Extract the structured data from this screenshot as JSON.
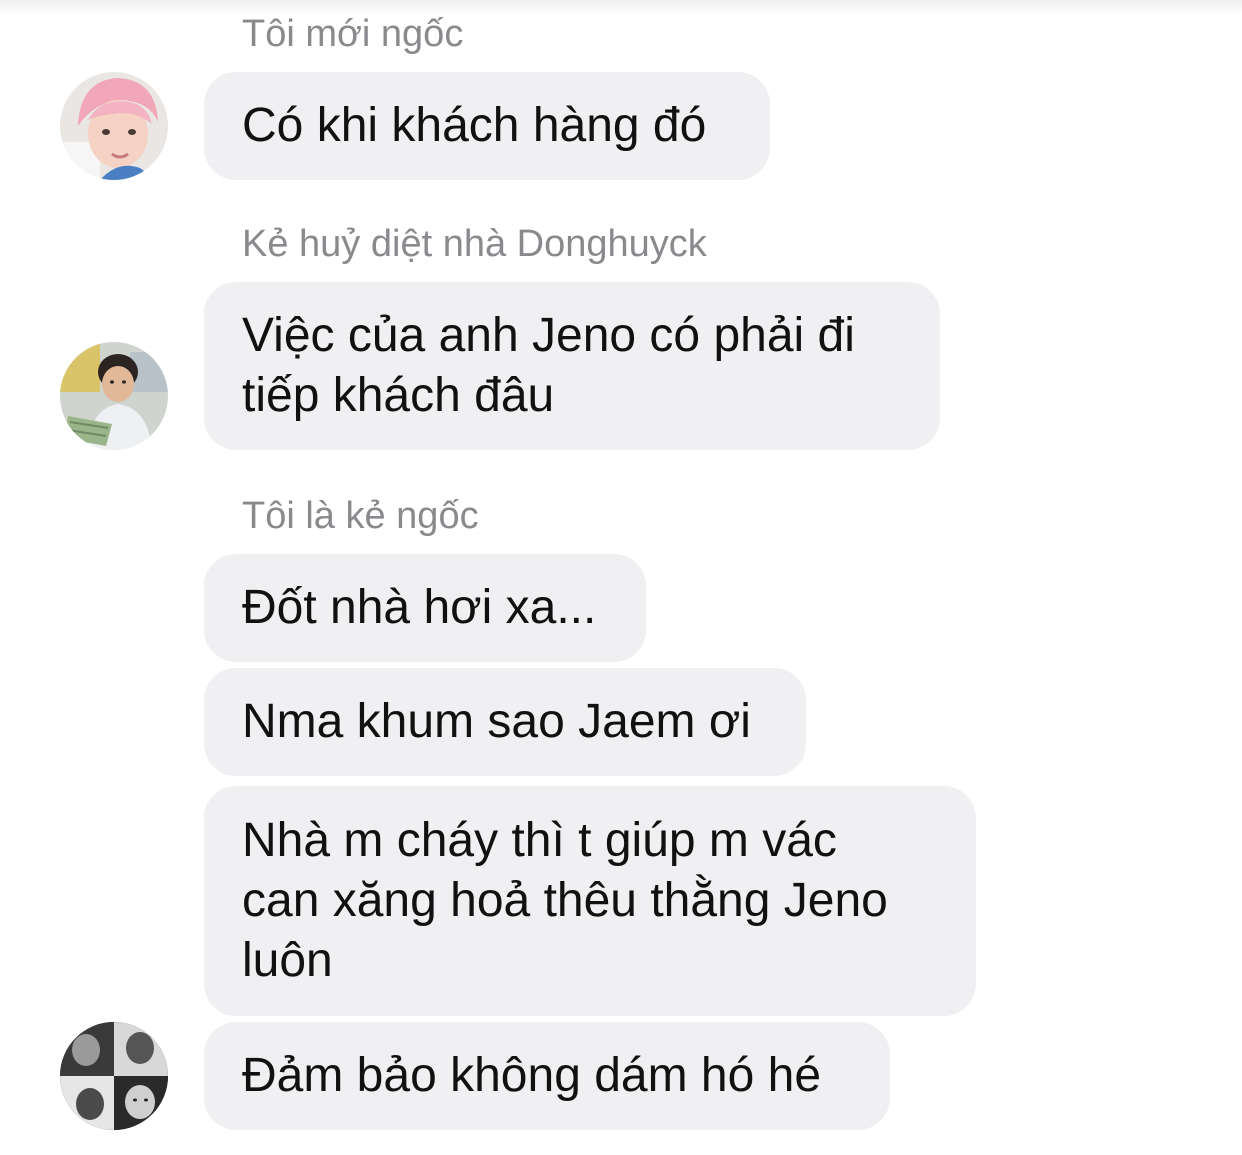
{
  "chat": {
    "groups": [
      {
        "sender": "Tôi mới ngốc",
        "avatar_icon": "pink-hair-person-avatar",
        "messages": [
          "Có khi khách hàng đó"
        ]
      },
      {
        "sender": "Kẻ huỷ diệt nhà Donghuyck",
        "avatar_icon": "boy-holding-money-avatar",
        "messages": [
          "Việc của anh Jeno có phải đi\ntiếp khách đâu"
        ]
      },
      {
        "sender": "Tôi là kẻ ngốc",
        "avatar_icon": "black-white-collage-avatar",
        "messages": [
          "Đốt nhà hơi xa...",
          "Nma khum sao Jaem ơi",
          "Nhà m cháy thì t giúp m vác\ncan xăng hoả thêu thằng Jeno\nluôn",
          "Đảm bảo không dám hó hé"
        ]
      }
    ]
  },
  "colors": {
    "bubble_bg": "#f0f0f2",
    "sender_text": "#8a8a8e",
    "message_text": "#111111"
  }
}
